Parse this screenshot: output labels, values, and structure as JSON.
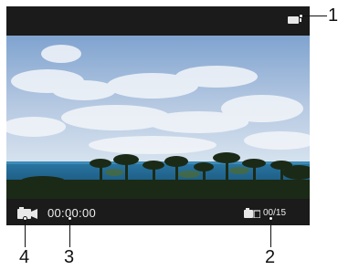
{
  "top_bar": {
    "battery_icon": "battery-icon"
  },
  "bottom_bar": {
    "mode_icon": "video-camera-icon",
    "timecode": "00:00:00",
    "photo_icon": "camera-icon",
    "counter": "00/15"
  },
  "callouts": [
    "1",
    "2",
    "3",
    "4"
  ],
  "colors": {
    "bar": "#1b1b1b",
    "sky": "#9cb6d8",
    "sea": "#1c5f86"
  }
}
